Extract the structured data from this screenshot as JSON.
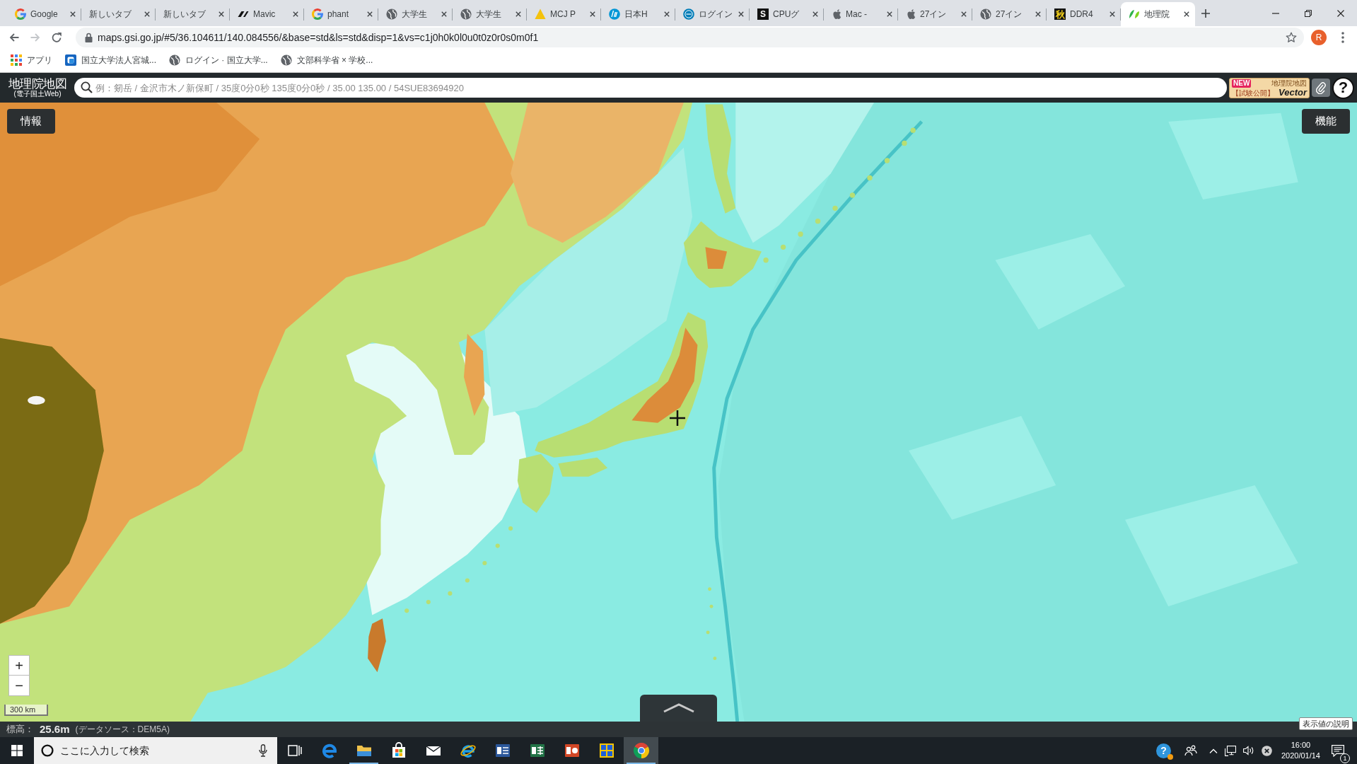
{
  "browser": {
    "tabs": [
      {
        "title": "Google",
        "kind": "ring",
        "selected": false
      },
      {
        "title": "新しいタブ",
        "kind": "none",
        "selected": false
      },
      {
        "title": "新しいタブ",
        "kind": "none",
        "selected": false
      },
      {
        "title": "Mavic",
        "kind": "logo",
        "selected": false
      },
      {
        "title": "phant",
        "kind": "ring",
        "selected": false
      },
      {
        "title": "大学生",
        "kind": "globe",
        "selected": false
      },
      {
        "title": "大学生",
        "kind": "globe",
        "selected": false
      },
      {
        "title": "MCJ P",
        "kind": "triangle",
        "selected": false
      },
      {
        "title": "日本H",
        "kind": "disc",
        "selected": false
      },
      {
        "title": "ログイン",
        "kind": "oval",
        "selected": false
      },
      {
        "title": "CPUグ",
        "kind": "letter",
        "letter": "S",
        "selected": false
      },
      {
        "title": "Mac -",
        "kind": "apple",
        "selected": false
      },
      {
        "title": "27イン",
        "kind": "apple",
        "selected": false
      },
      {
        "title": "27イン",
        "kind": "globe",
        "selected": false
      },
      {
        "title": "DDR4",
        "kind": "badge",
        "letter": "秋",
        "selected": false
      },
      {
        "title": "地理院",
        "kind": "sprout",
        "selected": true
      }
    ],
    "nav": [
      {
        "kind": "back",
        "disabled": false
      },
      {
        "kind": "forward",
        "disabled": true
      },
      {
        "kind": "reload",
        "disabled": false
      }
    ],
    "address_bar": {
      "url": "maps.gsi.go.jp/#5/36.104611/140.084556/&base=std&ls=std&disp=1&vs=c1j0h0k0l0u0t0z0r0s0m0f1"
    },
    "profile": {
      "initial": "R"
    },
    "bookmarks": [
      {
        "label": "アプリ",
        "kind": "apps"
      },
      {
        "label": "国立大学法人宮城...",
        "kind": "square"
      },
      {
        "label": "ログイン · 国立大学...",
        "kind": "globe"
      },
      {
        "label": "文部科学省 × 学校...",
        "kind": "globe"
      }
    ]
  },
  "gsi": {
    "logo": {
      "title": "地理院地図",
      "subtitle": "(電子国土Web)"
    },
    "search": {
      "placeholder": "例：剱岳 / 金沢市木ノ新保町 / 35度0分0秒 135度0分0秒 / 35.00 135.00 / 54SUE83694920"
    },
    "vector": {
      "badge": "NEW",
      "title": "地理院地図",
      "note": "【試験公開】",
      "label": "Vector"
    },
    "help": "?",
    "info_button": "情報",
    "menu_button": "機能",
    "zoom": {
      "in": "+",
      "out": "−"
    },
    "scale": "300 km",
    "legend_button": "表示値の説明",
    "elevation": {
      "label": "標高：",
      "value": "25.6m",
      "source": "(データソース：DEM5A)"
    }
  },
  "taskbar": {
    "search": {
      "placeholder": "ここに入力して検索"
    },
    "apps": [
      {
        "kind": "taskview",
        "running": false,
        "selected": false
      },
      {
        "kind": "edge",
        "running": false,
        "selected": false
      },
      {
        "kind": "explorer",
        "running": true,
        "selected": false
      },
      {
        "kind": "store",
        "running": false,
        "selected": false
      },
      {
        "kind": "mail",
        "running": false,
        "selected": false
      },
      {
        "kind": "ie",
        "running": false,
        "selected": false
      },
      {
        "kind": "word",
        "running": false,
        "selected": false
      },
      {
        "kind": "excel",
        "running": false,
        "selected": false
      },
      {
        "kind": "powerpoint",
        "running": false,
        "selected": false
      },
      {
        "kind": "tiles",
        "running": false,
        "selected": false
      },
      {
        "kind": "chrome",
        "running": true,
        "selected": true
      }
    ],
    "tray": {
      "help": "?"
    },
    "clock": {
      "time": "16:00",
      "date": "2020/01/14"
    },
    "notifications": "1"
  }
}
